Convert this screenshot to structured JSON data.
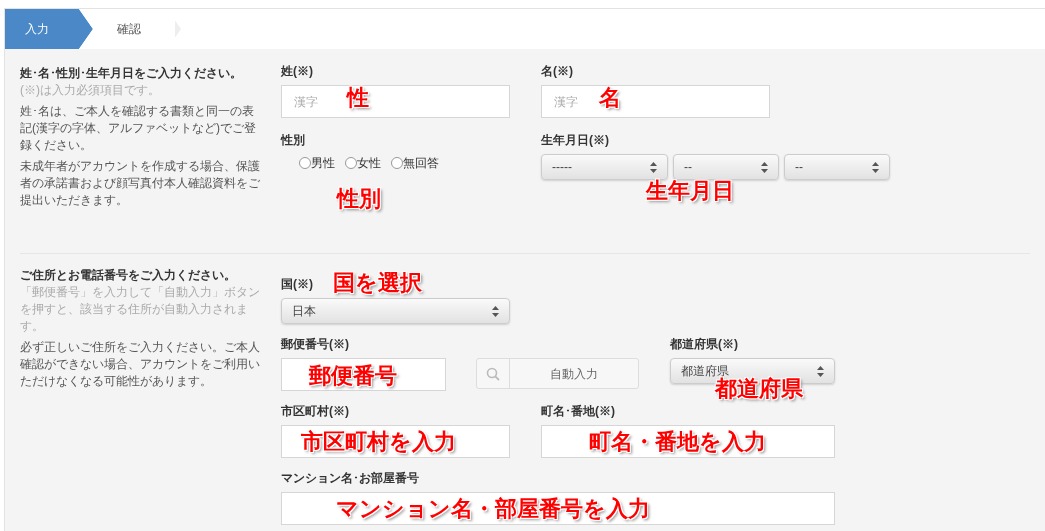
{
  "steps": [
    {
      "label": "入力",
      "selected": true
    },
    {
      "label": "確認",
      "selected": false
    }
  ],
  "personal": {
    "heading": "姓･名･性別･生年月日をご入力ください。",
    "notes": [
      {
        "text": "(※)は入力必須項目です。",
        "muted": true
      },
      {
        "text": "姓･名は、ご本人を確認する書類と同一の表記(漢字の字体、アルファベットなど)でご登録ください。",
        "muted": false
      },
      {
        "text": "未成年者がアカウントを作成する場合、保護者の承諾書および顔写真付本人確認資料をご提出いただきます。",
        "muted": false
      }
    ],
    "last_name": {
      "label": "姓(※)",
      "placeholder": "漢字",
      "annotation": "性"
    },
    "first_name": {
      "label": "名(※)",
      "placeholder": "漢字",
      "annotation": "名"
    },
    "gender": {
      "label": "性別",
      "options": [
        {
          "label": "男性",
          "selected": false
        },
        {
          "label": "女性",
          "selected": false
        },
        {
          "label": "無回答",
          "selected": false
        }
      ],
      "annotation": "性別"
    },
    "birthdate": {
      "label": "生年月日(※)",
      "selects": [
        "-----",
        "--",
        "--"
      ],
      "annotation": "生年月日"
    }
  },
  "address": {
    "heading": "ご住所とお電話番号をご入力ください。",
    "notes": [
      {
        "text": "「郵便番号」を入力して「自動入力」ボタンを押すと、該当する住所が自動入力されます。",
        "muted": true
      },
      {
        "text": "必ず正しいご住所をご入力ください。ご本人確認ができない場合、アカウントをご利用いただけなくなる可能性があります。",
        "muted": false
      }
    ],
    "country": {
      "label": "国(※)",
      "value": "日本",
      "annotation": "国を選択"
    },
    "postal": {
      "label": "郵便番号(※)",
      "annotation": "郵便番号"
    },
    "autofill": {
      "label": "自動入力"
    },
    "prefecture": {
      "label": "都道府県(※)",
      "value": "都道府県",
      "annotation": "都道府県"
    },
    "city": {
      "label": "市区町村(※)",
      "annotation": "市区町村を入力"
    },
    "town": {
      "label": "町名･番地(※)",
      "annotation": "町名・番地を入力"
    },
    "building": {
      "label": "マンション名･お部屋番号",
      "annotation": "マンション名・部屋番号を入力"
    }
  }
}
